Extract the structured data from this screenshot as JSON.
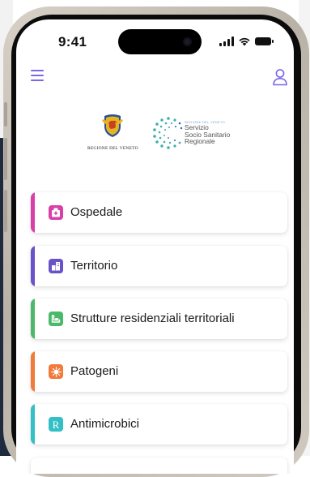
{
  "status_bar": {
    "time": "9:41"
  },
  "header": {
    "menu_icon": "hamburger-icon",
    "user_icon": "user-icon"
  },
  "logos": {
    "veneto_text": "REGIONE DEL VENETO",
    "sanitario_tagline": "REGIONE DEL VENETO",
    "sanitario_line1": "Servizio",
    "sanitario_line2": "Socio Sanitario",
    "sanitario_line3": "Regionale"
  },
  "menu": {
    "items": [
      {
        "label": "Ospedale",
        "color": "#d93fa7",
        "icon": "hospital-icon"
      },
      {
        "label": "Territorio",
        "color": "#6a52c8",
        "icon": "buildings-icon"
      },
      {
        "label": "Strutture residenziali territoriali",
        "color": "#4bb86a",
        "icon": "bed-icon"
      },
      {
        "label": "Patogeni",
        "color": "#f07b3a",
        "icon": "pathogen-icon"
      },
      {
        "label": "Antimicrobici",
        "color": "#32bfc6",
        "icon": "rx-icon",
        "icon_glyph": "R"
      }
    ]
  }
}
